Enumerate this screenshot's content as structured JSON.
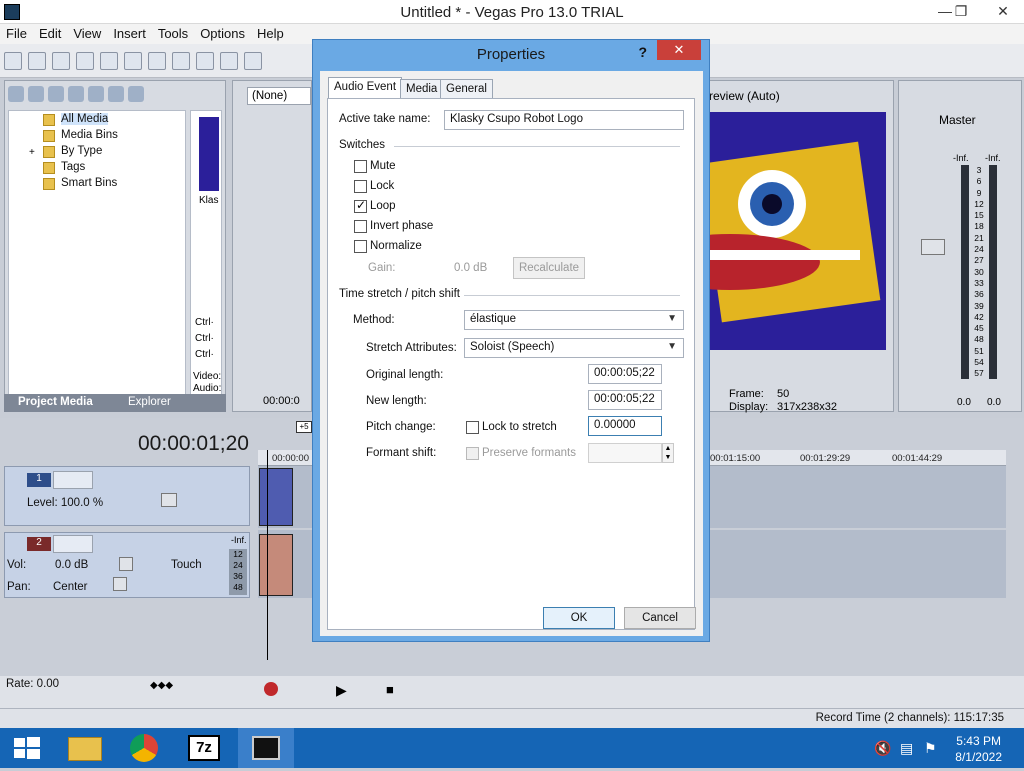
{
  "window": {
    "title": "Untitled * - Vegas Pro 13.0 TRIAL"
  },
  "menu": [
    "File",
    "Edit",
    "View",
    "Insert",
    "Tools",
    "Options",
    "Help"
  ],
  "media_pane": {
    "tree": [
      "All Media",
      "Media Bins",
      "By Type",
      "Tags",
      "Smart Bins"
    ],
    "thumb_label": "Klas",
    "tabs": [
      "Project Media",
      "Explorer"
    ],
    "ctrl_labels": [
      "Ctrl·",
      "Ctrl·",
      "Ctrl·"
    ],
    "video_label": "Video:",
    "audio_label": "Audio:"
  },
  "trimmer": {
    "selector": "(None)",
    "time": "00:00:0"
  },
  "preview": {
    "mode": "review (Auto)",
    "frame_label": "Frame:",
    "frame_value": "50",
    "display_label": "Display:",
    "display_value": "317x238x32"
  },
  "master": {
    "title": "Master",
    "inf_left": "-Inf.",
    "inf_right": "-Inf.",
    "scale": [
      "3",
      "6",
      "9",
      "12",
      "15",
      "18",
      "21",
      "24",
      "27",
      "30",
      "33",
      "36",
      "39",
      "42",
      "45",
      "48",
      "51",
      "54",
      "57"
    ],
    "value_left": "0.0",
    "value_right": "0.0"
  },
  "timeline": {
    "timecode": "00:00:01;20",
    "ruler": [
      "00:00:00",
      "00:01:15:00",
      "00:01:29:29",
      "00:01:44:29"
    ],
    "marker": "+5",
    "track1": {
      "number": "1",
      "level": "Level: 100.0 %"
    },
    "track2": {
      "number": "2",
      "vol": "Vol:",
      "vol_value": "0.0 dB",
      "pan": "Pan:",
      "pan_value": "Center",
      "mode": "Touch",
      "inf": "-Inf.",
      "meter": [
        "12",
        "24",
        "36",
        "48"
      ]
    },
    "rate": "Rate: 0.00",
    "record_time": "Record Time (2 channels): 115:17:35"
  },
  "taskbar": {
    "time": "5:43 PM",
    "date": "8/1/2022",
    "app_7z": "7z"
  },
  "dialog": {
    "title": "Properties",
    "help": "?",
    "close": "✕",
    "tabs": [
      "Audio Event",
      "Media",
      "General"
    ],
    "active_take_label": "Active take name:",
    "active_take_value": "Klasky Csupo Robot Logo",
    "switches_label": "Switches",
    "switches": [
      {
        "label": "Mute",
        "checked": false
      },
      {
        "label": "Lock",
        "checked": false
      },
      {
        "label": "Loop",
        "checked": true
      },
      {
        "label": "Invert phase",
        "checked": false
      },
      {
        "label": "Normalize",
        "checked": false
      }
    ],
    "gain_label": "Gain:",
    "gain_value": "0.0 dB",
    "recalculate": "Recalculate",
    "stretch_label": "Time stretch / pitch shift",
    "method_label": "Method:",
    "method_value": "élastique",
    "stretch_attr_label": "Stretch Attributes:",
    "stretch_attr_value": "Soloist (Speech)",
    "original_length_label": "Original length:",
    "original_length_value": "00:00:05;22",
    "new_length_label": "New length:",
    "new_length_value": "00:00:05;22",
    "pitch_label": "Pitch change:",
    "lock_to_stretch": "Lock to stretch",
    "pitch_value": "0.00000",
    "formant_label": "Formant shift:",
    "preserve_formants": "Preserve formants",
    "ok": "OK",
    "cancel": "Cancel"
  }
}
